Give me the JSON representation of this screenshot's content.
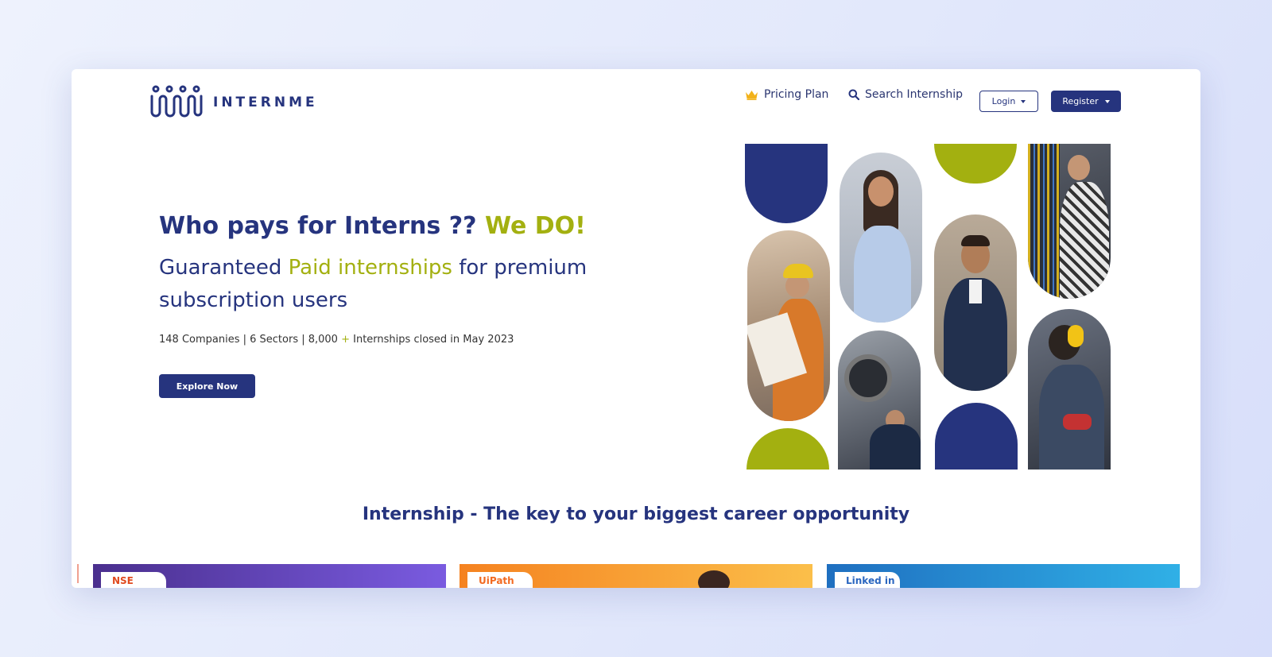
{
  "header": {
    "logo_text": "INTERNME",
    "nav": {
      "pricing": "Pricing Plan",
      "search": "Search Internship"
    },
    "login_label": "Login",
    "register_label": "Register"
  },
  "hero": {
    "title_main": "Who pays for Interns ?? ",
    "title_accent": "We DO!",
    "sub_a": "Guaranteed ",
    "sub_accent": "Paid internships",
    "sub_b": " for premium subscription users",
    "stats_a": "148 Companies | 6 Sectors | 8,000 ",
    "stats_plus": "+",
    "stats_b": " Internships closed in May 2023",
    "cta_label": "Explore Now"
  },
  "section": {
    "title": "Internship - The key to your biggest career opportunity"
  },
  "cards": [
    {
      "badge": "NSE",
      "badge_color": "#e04a1e",
      "bg": "#5a3fb0"
    },
    {
      "badge": "UiPath",
      "badge_color": "#f26a21",
      "bg": "#f7941d"
    },
    {
      "badge": "Linked in",
      "badge_color": "#2a66c0",
      "bg": "#2a80d2"
    }
  ],
  "colors": {
    "navy": "#26347e",
    "lime": "#a3b010",
    "crown": "#f2b21a"
  },
  "icons": [
    "crown-icon",
    "search-icon",
    "logo-icon"
  ]
}
